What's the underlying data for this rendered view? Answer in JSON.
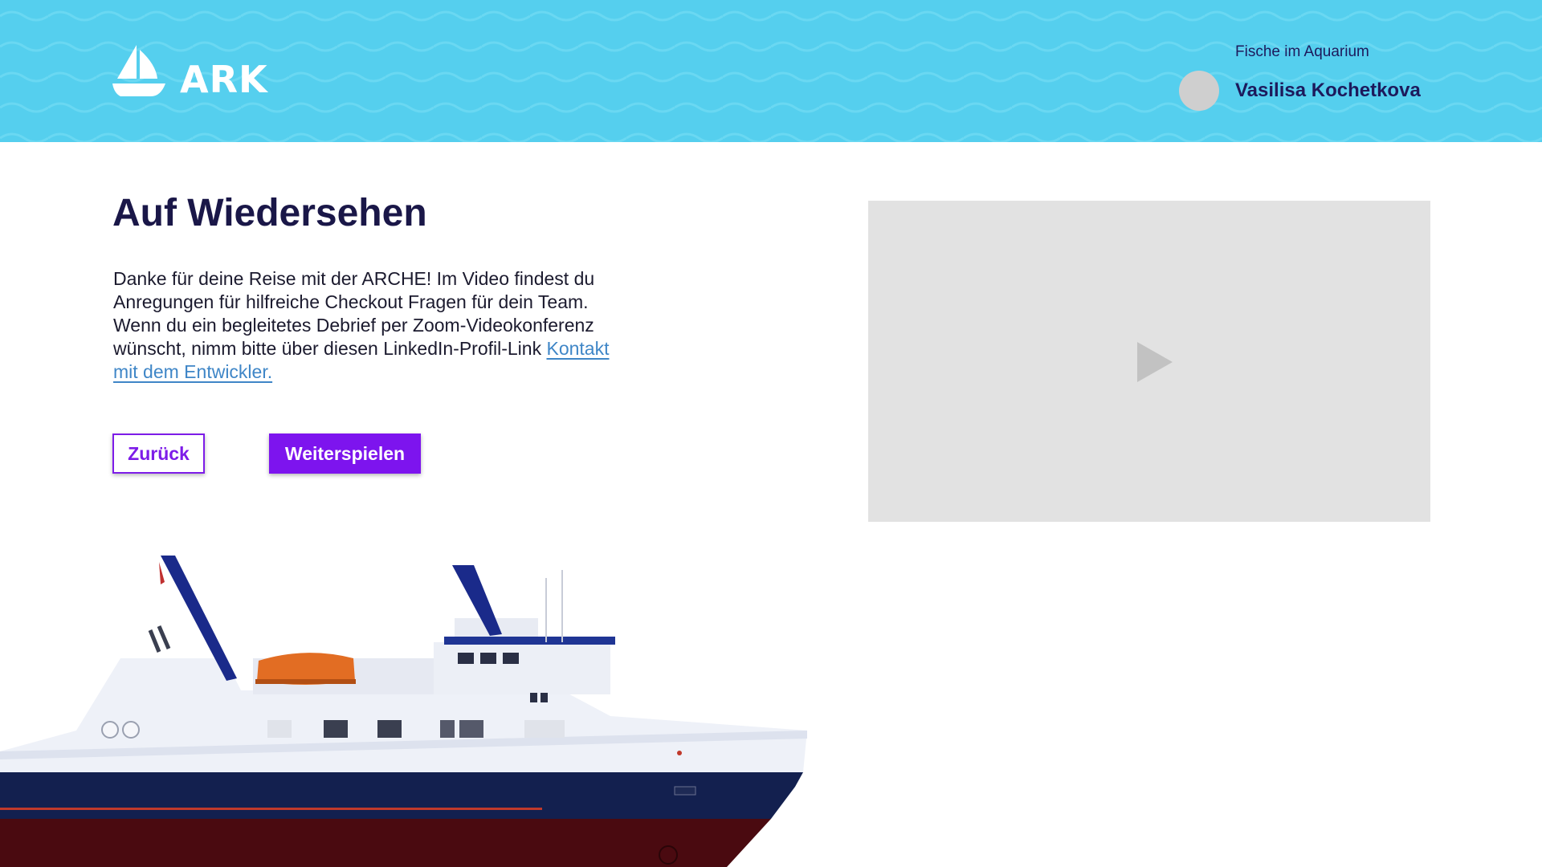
{
  "header": {
    "logo_text": "ARK",
    "group_name": "Fische im Aquarium",
    "user_name": "Vasilisa Kochetkova",
    "background_color": "#55cfee"
  },
  "main": {
    "title": "Auf Wiedersehen",
    "body_text": "Danke für deine Reise mit der ARCHE! Im Video findest du Anregungen für hilfreiche Checkout Fragen für dein Team. Wenn du ein begleitetes Debrief per Zoom-Videokonferenz wünscht, nimm bitte über diesen LinkedIn-Profil-Link",
    "link_text": "Kontakt mit dem Entwickler.",
    "back_button": "Zurück",
    "continue_button": "Weiterspielen"
  },
  "video": {
    "play_icon": "play-icon"
  },
  "icons": {
    "logo": "sailboat-icon",
    "avatar": "avatar",
    "illustration": "ship-illustration"
  },
  "colors": {
    "accent": "#7d14ee",
    "title": "#1a1748",
    "link": "#3f86c7",
    "video_bg": "#e2e2e2"
  }
}
